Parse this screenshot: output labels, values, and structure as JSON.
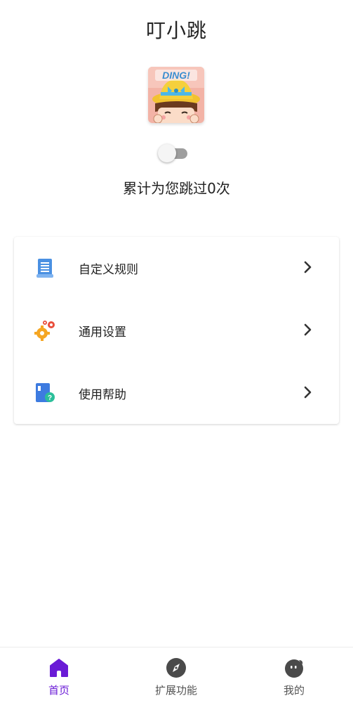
{
  "header": {
    "title": "叮小跳",
    "logo_text": "DING!"
  },
  "switch": {
    "enabled": false
  },
  "stats": {
    "counter_text": "累计为您跳过0次"
  },
  "menu": {
    "items": [
      {
        "label": "自定义规则",
        "icon": "document-rules-icon"
      },
      {
        "label": "通用设置",
        "icon": "gears-settings-icon"
      },
      {
        "label": "使用帮助",
        "icon": "help-book-icon"
      }
    ]
  },
  "bottom_nav": {
    "items": [
      {
        "label": "首页",
        "icon": "home-icon",
        "active": true
      },
      {
        "label": "扩展功能",
        "icon": "compass-icon",
        "active": false
      },
      {
        "label": "我的",
        "icon": "profile-face-icon",
        "active": false
      }
    ]
  },
  "colors": {
    "accent": "#6a1bd6",
    "nav_inactive": "#555555",
    "toggle_track": "#9e9e9e"
  }
}
